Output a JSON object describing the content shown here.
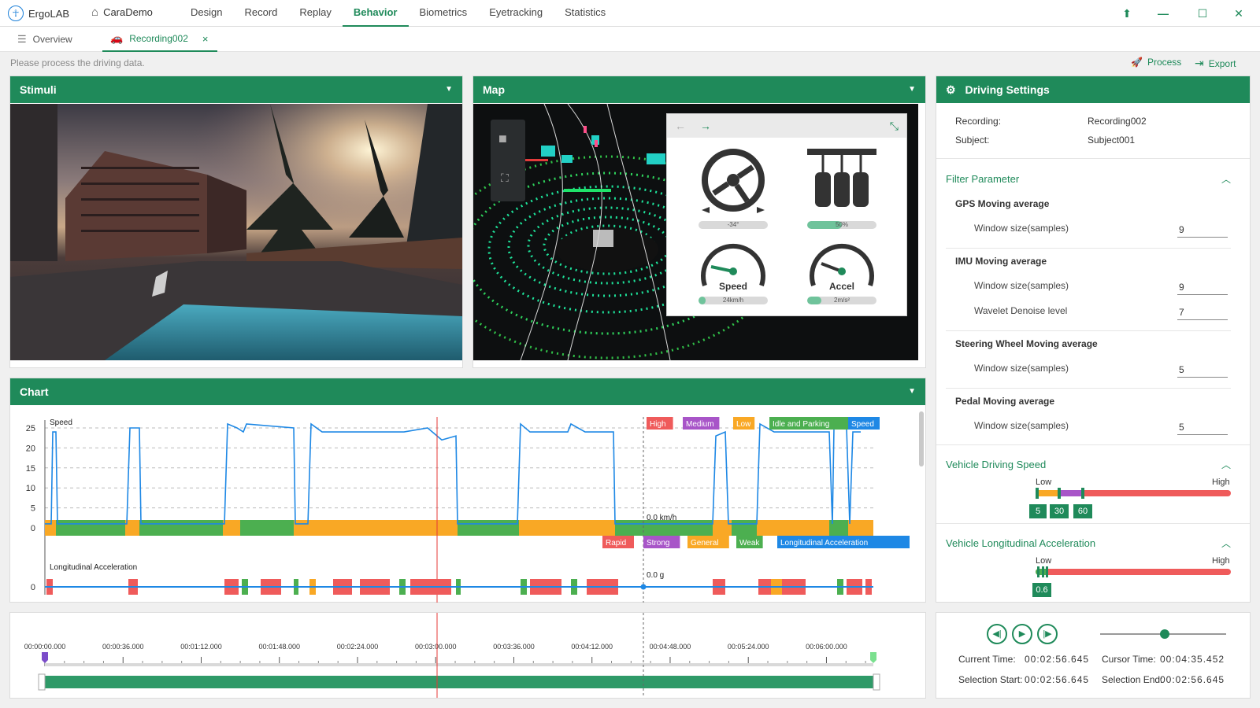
{
  "app": {
    "name": "ErgoLAB",
    "project": "CaraDemo"
  },
  "nav": [
    "Design",
    "Record",
    "Replay",
    "Behavior",
    "Biometrics",
    "Eyetracking",
    "Statistics"
  ],
  "nav_active": "Behavior",
  "tabs": {
    "overview": "Overview",
    "recording": "Recording002",
    "close": "×"
  },
  "hint": "Please process the driving data.",
  "actions": {
    "process": "Process",
    "export": "Export"
  },
  "panels": {
    "stimuli": "Stimuli",
    "map": "Map",
    "chart": "Chart",
    "settings": "Driving Settings"
  },
  "dashboard": {
    "steering": {
      "label": "-34°",
      "fraction": 0.0
    },
    "pedal": {
      "label": "50%",
      "fraction": 0.5
    },
    "speed": {
      "name": "Speed",
      "label": "24km/h",
      "fraction": 0.1
    },
    "accel": {
      "name": "Accel",
      "label": "2m/s²",
      "fraction": 0.2
    }
  },
  "settings": {
    "recording_label": "Recording:",
    "recording_value": "Recording002",
    "subject_label": "Subject:",
    "subject_value": "Subject001",
    "filter_title": "Filter Parameter",
    "gps_title": "GPS Moving average",
    "gps_window_label": "Window size(samples)",
    "gps_window": "9",
    "imu_title": "IMU Moving average",
    "imu_window_label": "Window size(samples)",
    "imu_window": "9",
    "imu_wavelet_label": "Wavelet Denoise level",
    "imu_wavelet": "7",
    "steer_title": "Steering Wheel Moving average",
    "steer_window_label": "Window size(samples)",
    "steer_window": "5",
    "pedal_title": "Pedal Moving average",
    "pedal_window_label": "Window size(samples)",
    "pedal_window": "5",
    "speed_title": "Vehicle Driving Speed",
    "speed_low": "Low",
    "speed_high": "High",
    "speed_thresholds": [
      "5",
      "30",
      "60"
    ],
    "accel_title": "Vehicle Longitudinal Acceleration",
    "accel_low": "Low",
    "accel_high": "High",
    "accel_threshold": "0.6"
  },
  "chart_data": {
    "type": "line",
    "series": [
      {
        "name": "Speed",
        "ylim": [
          0,
          25
        ],
        "yticks": [
          0,
          5,
          10,
          15,
          20,
          25
        ]
      },
      {
        "name": "Longitudinal Acceleration",
        "yticks": [
          0
        ]
      }
    ],
    "speed_legend": [
      "High",
      "Medium",
      "Low",
      "Idle and Parking",
      "Speed"
    ],
    "accel_legend": [
      "Rapid",
      "Strong",
      "General",
      "Weak",
      "Longitudinal Acceleration"
    ],
    "cursor_readout": "0.0 km/h",
    "cursor_readout2": "0.0 g",
    "speed_label": "Speed",
    "accel_label": "Longitudinal Acceleration"
  },
  "colors": {
    "accent": "#1f8a5a",
    "high": "#ef5b5b",
    "medium": "#a855c8",
    "low": "#f9a825",
    "idle": "#4caf50",
    "speed": "#1e88e5"
  },
  "timeline": {
    "ticks": [
      "00:00:00.000",
      "00:00:36.000",
      "00:01:12.000",
      "00:01:48.000",
      "00:02:24.000",
      "00:03:00.000",
      "00:03:36.000",
      "00:04:12.000",
      "00:04:48.000",
      "00:05:24.000",
      "00:06:00.000"
    ]
  },
  "playback": {
    "current_label": "Current Time:",
    "current": "00:02:56.645",
    "cursor_label": "Cursor Time:",
    "cursor": "00:04:35.452",
    "sel_start_label": "Selection Start:",
    "sel_start": "00:02:56.645",
    "sel_end_label": "Selection End:",
    "sel_end": "00:02:56.645"
  }
}
